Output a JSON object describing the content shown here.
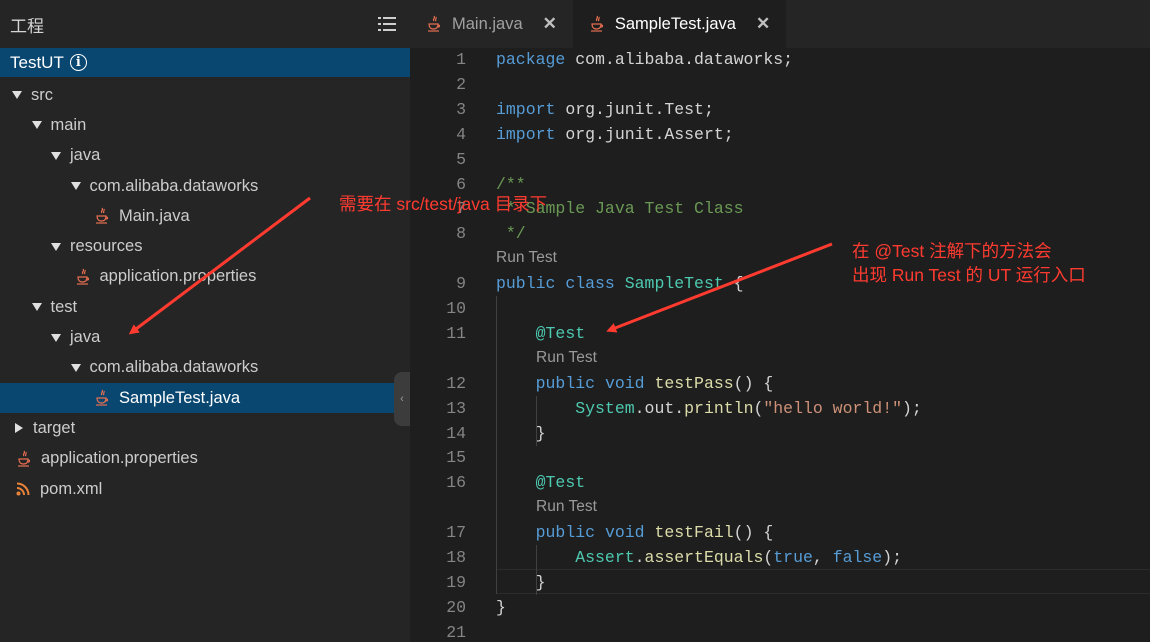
{
  "sidebar": {
    "title": "工程",
    "project": "TestUT",
    "tree": [
      {
        "label": "src",
        "depth": 0,
        "type": "folder",
        "expanded": true
      },
      {
        "label": "main",
        "depth": 1,
        "type": "folder",
        "expanded": true
      },
      {
        "label": "java",
        "depth": 2,
        "type": "folder",
        "expanded": true
      },
      {
        "label": "com.alibaba.dataworks",
        "depth": 3,
        "type": "folder",
        "expanded": true
      },
      {
        "label": "Main.java",
        "depth": 4,
        "type": "java"
      },
      {
        "label": "resources",
        "depth": 2,
        "type": "folder",
        "expanded": true
      },
      {
        "label": "application.properties",
        "depth": 3,
        "type": "java"
      },
      {
        "label": "test",
        "depth": 1,
        "type": "folder",
        "expanded": true
      },
      {
        "label": "java",
        "depth": 2,
        "type": "folder",
        "expanded": true
      },
      {
        "label": "com.alibaba.dataworks",
        "depth": 3,
        "type": "folder",
        "expanded": true
      },
      {
        "label": "SampleTest.java",
        "depth": 4,
        "type": "java",
        "selected": true
      },
      {
        "label": "target",
        "depth": 0,
        "type": "folder",
        "expanded": false
      },
      {
        "label": "application.properties",
        "depth": 0,
        "type": "java"
      },
      {
        "label": "pom.xml",
        "depth": 0,
        "type": "rss"
      }
    ]
  },
  "tabs": [
    {
      "label": "Main.java",
      "active": false
    },
    {
      "label": "SampleTest.java",
      "active": true
    }
  ],
  "editor": {
    "lines": [
      {
        "n": "1",
        "html": "<span class='kw'>package</span> com.alibaba.dataworks;"
      },
      {
        "n": "2",
        "html": ""
      },
      {
        "n": "3",
        "html": "<span class='kw'>import</span> org.junit.Test;"
      },
      {
        "n": "4",
        "html": "<span class='kw'>import</span> org.junit.Assert;"
      },
      {
        "n": "5",
        "html": ""
      },
      {
        "n": "6",
        "html": "<span class='cmt'>/**</span>"
      },
      {
        "n": "7",
        "html": "<span class='cmt'> * Sample Java Test Class</span>"
      },
      {
        "n": "8",
        "html": "<span class='cmt'> */</span>"
      },
      {
        "lens": "Run Test",
        "indent": 0
      },
      {
        "n": "9",
        "html": "<span class='kw'>public</span> <span class='kw'>class</span> <span class='cls'>SampleTest</span> {"
      },
      {
        "n": "10",
        "html": ""
      },
      {
        "n": "11",
        "html": "    <span class='ann'>@Test</span>"
      },
      {
        "lens": "Run Test",
        "indent": 1
      },
      {
        "n": "12",
        "html": "    <span class='kw'>public</span> <span class='kw'>void</span> <span class='fn'>testPass</span>() {"
      },
      {
        "n": "13",
        "html": "        <span class='cls'>System</span>.out.<span class='fn'>println</span>(<span class='str'>\"hello world!\"</span>);"
      },
      {
        "n": "14",
        "html": "    }"
      },
      {
        "n": "15",
        "html": ""
      },
      {
        "n": "16",
        "html": "    <span class='ann'>@Test</span>"
      },
      {
        "lens": "Run Test",
        "indent": 1
      },
      {
        "n": "17",
        "html": "    <span class='kw'>public</span> <span class='kw'>void</span> <span class='fn'>testFail</span>() {"
      },
      {
        "n": "18",
        "html": "        <span class='cls'>Assert</span>.<span class='fn'>assertEquals</span>(<span class='kw'>true</span>, <span class='kw'>false</span>);"
      },
      {
        "n": "19",
        "html": "    }"
      },
      {
        "n": "20",
        "html": "}"
      },
      {
        "n": "21",
        "html": ""
      }
    ]
  },
  "annotations": {
    "note1": "需要在 src/test/java 目录下",
    "note2_line1": "在 @Test 注解下的方法会",
    "note2_line2": "出现 Run Test 的 UT 运行入口"
  },
  "colors": {
    "accent": "#094771",
    "annotation": "#ff3b30",
    "keyword": "#569cd6",
    "type": "#4ec9b0"
  }
}
